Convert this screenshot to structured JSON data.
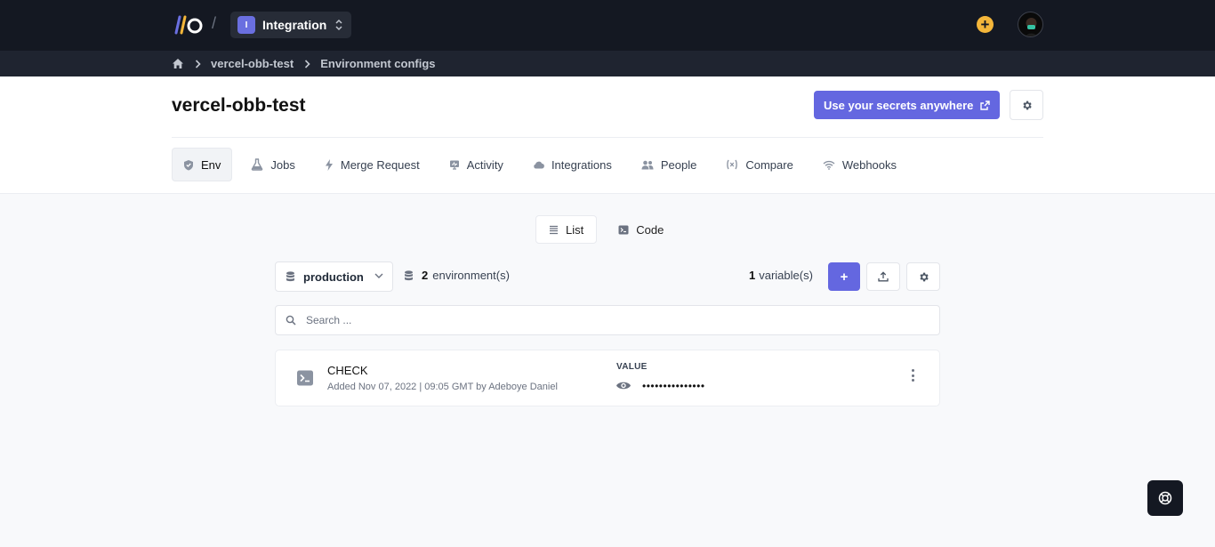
{
  "topbar": {
    "separator": "/",
    "org_badge": "I",
    "org_name": "Integration"
  },
  "breadcrumb": {
    "items": [
      "vercel-obb-test",
      "Environment configs"
    ]
  },
  "header": {
    "title": "vercel-obb-test",
    "cta_label": "Use your secrets anywhere",
    "tabs": [
      {
        "label": "Env",
        "icon": "shield-icon"
      },
      {
        "label": "Jobs",
        "icon": "flask-icon"
      },
      {
        "label": "Merge Request",
        "icon": "bolt-icon"
      },
      {
        "label": "Activity",
        "icon": "activity-icon"
      },
      {
        "label": "Integrations",
        "icon": "cloud-icon"
      },
      {
        "label": "People",
        "icon": "users-icon"
      },
      {
        "label": "Compare",
        "icon": "variable-icon"
      },
      {
        "label": "Webhooks",
        "icon": "wifi-icon"
      }
    ]
  },
  "view_toggle": {
    "list_label": "List",
    "code_label": "Code",
    "selected": "List"
  },
  "toolbar": {
    "environment": "production",
    "env_count": "2",
    "env_count_label": "environment(s)",
    "var_count": "1",
    "var_count_label": "variable(s)",
    "add_label": "+"
  },
  "search": {
    "placeholder": "Search ..."
  },
  "variables": [
    {
      "name": "CHECK",
      "meta": "Added Nov 07, 2022 | 09:05 GMT by Adeboye Daniel",
      "value_label": "VALUE",
      "masked_value": "•••••••••••••••"
    }
  ],
  "colors": {
    "topbar_bg": "#141822",
    "crumbbar_bg": "#1f2430",
    "accent": "#6467e0",
    "plus_yellow": "#f4b63a",
    "page_bg": "#f8f9fb"
  }
}
